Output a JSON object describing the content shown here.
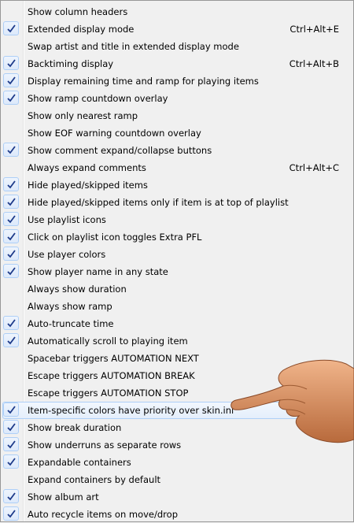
{
  "menu": {
    "items": [
      {
        "label": "Show column headers",
        "checked": false,
        "shortcut": ""
      },
      {
        "label": "Extended display mode",
        "checked": true,
        "shortcut": "Ctrl+Alt+E"
      },
      {
        "label": "Swap artist and title in extended display mode",
        "checked": false,
        "shortcut": ""
      },
      {
        "label": "Backtiming display",
        "checked": true,
        "shortcut": "Ctrl+Alt+B"
      },
      {
        "label": "Display remaining time and ramp for playing items",
        "checked": true,
        "shortcut": ""
      },
      {
        "label": "Show ramp countdown overlay",
        "checked": true,
        "shortcut": ""
      },
      {
        "label": "Show only nearest ramp",
        "checked": false,
        "shortcut": ""
      },
      {
        "label": "Show EOF warning countdown overlay",
        "checked": false,
        "shortcut": ""
      },
      {
        "label": "Show comment expand/collapse buttons",
        "checked": true,
        "shortcut": ""
      },
      {
        "label": "Always expand comments",
        "checked": false,
        "shortcut": "Ctrl+Alt+C"
      },
      {
        "label": "Hide played/skipped items",
        "checked": true,
        "shortcut": ""
      },
      {
        "label": "Hide played/skipped items only if item is at top of playlist",
        "checked": true,
        "shortcut": ""
      },
      {
        "label": "Use playlist icons",
        "checked": true,
        "shortcut": ""
      },
      {
        "label": "Click on playlist icon toggles Extra PFL",
        "checked": true,
        "shortcut": ""
      },
      {
        "label": "Use player colors",
        "checked": true,
        "shortcut": ""
      },
      {
        "label": "Show player name in any state",
        "checked": true,
        "shortcut": ""
      },
      {
        "label": "Always show duration",
        "checked": false,
        "shortcut": ""
      },
      {
        "label": "Always show ramp",
        "checked": false,
        "shortcut": ""
      },
      {
        "label": "Auto-truncate time",
        "checked": true,
        "shortcut": ""
      },
      {
        "label": "Automatically scroll to playing item",
        "checked": true,
        "shortcut": ""
      },
      {
        "label": "Spacebar triggers AUTOMATION NEXT",
        "checked": false,
        "shortcut": ""
      },
      {
        "label": "Escape triggers AUTOMATION BREAK",
        "checked": false,
        "shortcut": ""
      },
      {
        "label": "Escape triggers AUTOMATION STOP",
        "checked": false,
        "shortcut": ""
      },
      {
        "label": "Item-specific colors have priority over skin.ini",
        "checked": true,
        "shortcut": "",
        "highlighted": true
      },
      {
        "label": "Show break duration",
        "checked": true,
        "shortcut": ""
      },
      {
        "label": "Show underruns as separate rows",
        "checked": true,
        "shortcut": ""
      },
      {
        "label": "Expandable containers",
        "checked": true,
        "shortcut": ""
      },
      {
        "label": "Expand containers by default",
        "checked": false,
        "shortcut": ""
      },
      {
        "label": "Show album art",
        "checked": true,
        "shortcut": ""
      },
      {
        "label": "Auto recycle items on move/drop",
        "checked": true,
        "shortcut": ""
      }
    ]
  },
  "colors": {
    "check": "#1d3a8a",
    "highlight_border": "#aecff7",
    "menu_bg": "#f0f0f0"
  },
  "icons": {
    "check": "checkmark-icon",
    "pointer": "pointing-hand-icon"
  }
}
